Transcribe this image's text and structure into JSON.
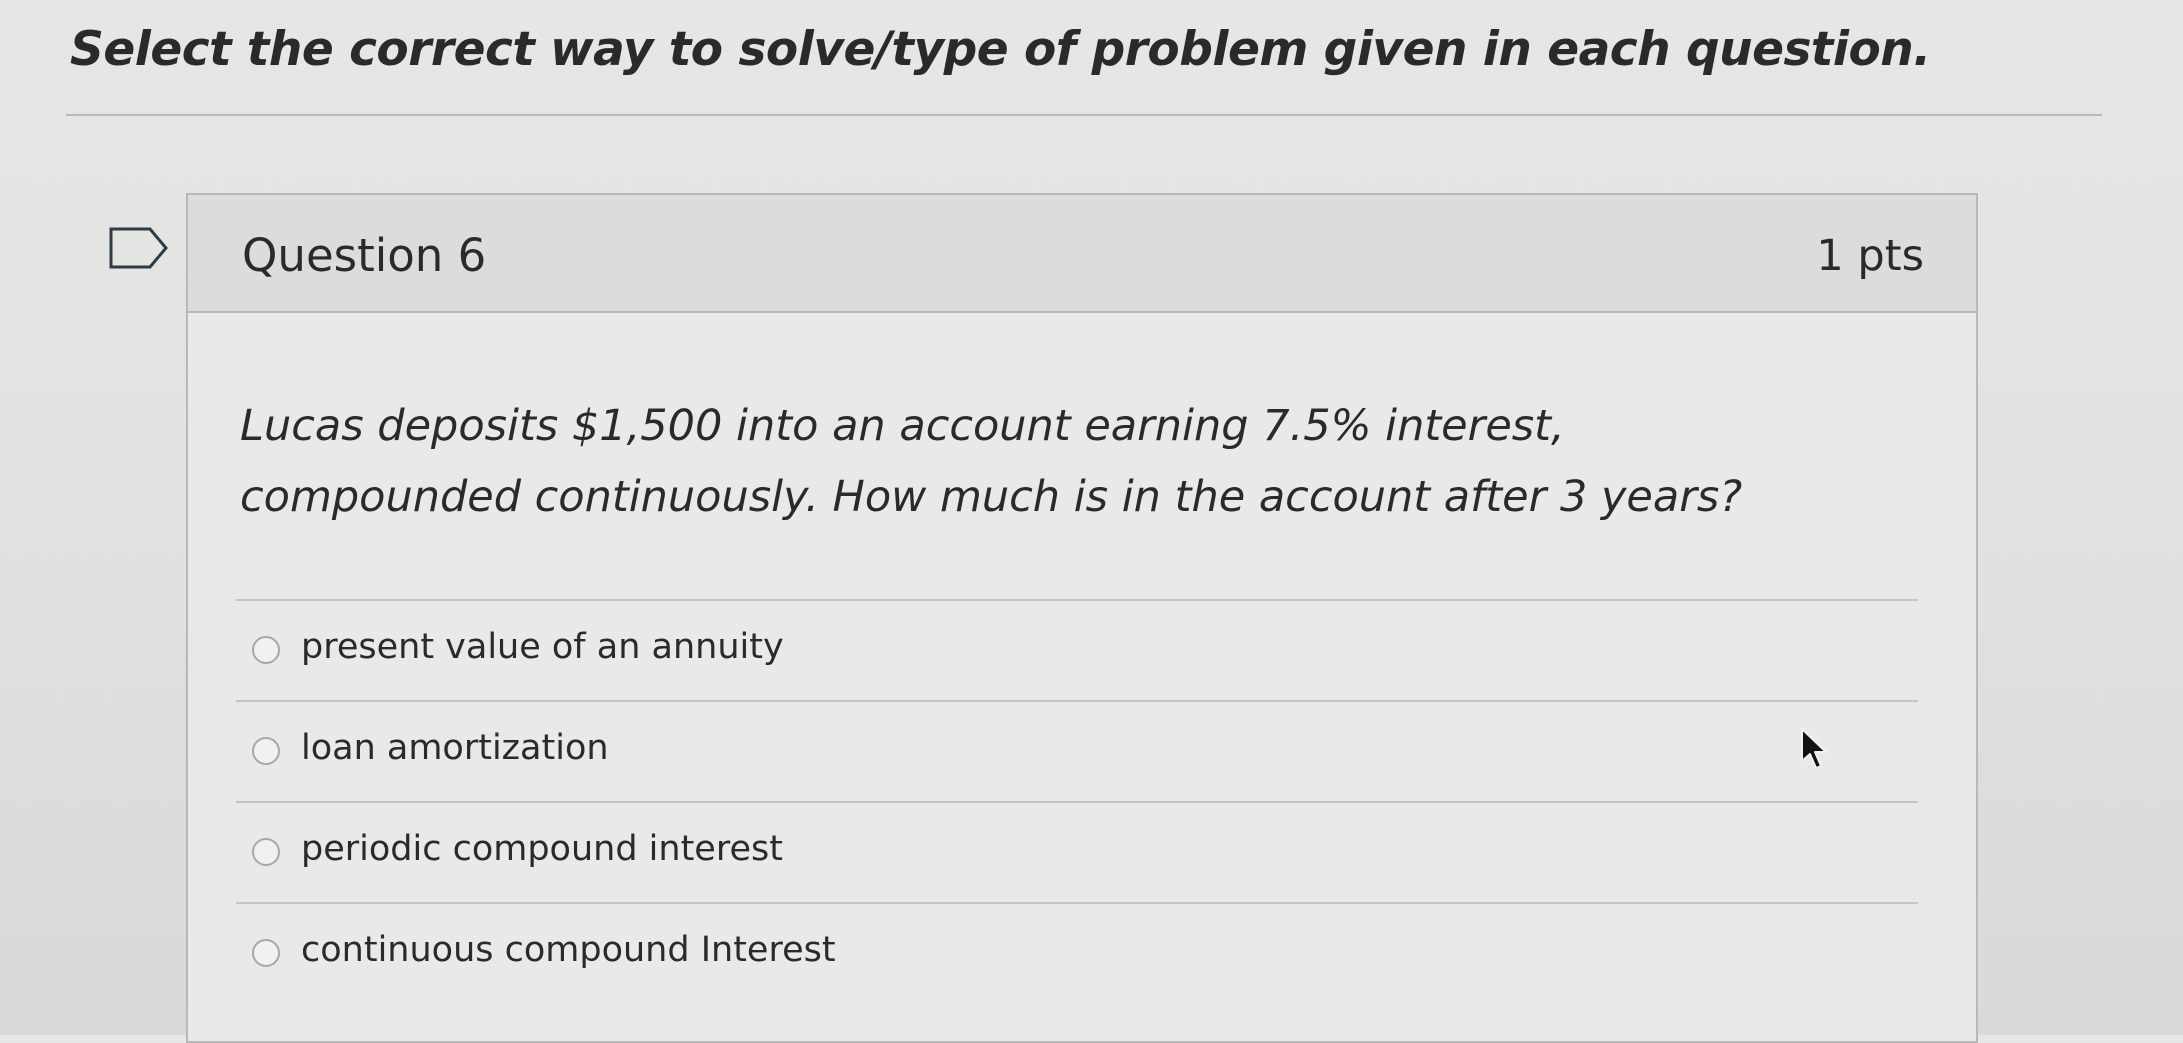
{
  "quiz": {
    "instructions": "Select the correct way to solve/type of problem given in each question."
  },
  "question": {
    "title": "Question 6",
    "points": "1 pts",
    "text": "Lucas deposits $1,500 into an account earning 7.5% interest, compounded continuously. How much is in the account after 3 years?",
    "answers": [
      {
        "label": "present value of an annuity",
        "selected": false
      },
      {
        "label": "loan amortization",
        "selected": false
      },
      {
        "label": "periodic compound interest",
        "selected": false
      },
      {
        "label": "continuous compound Interest",
        "selected": false
      }
    ]
  },
  "icons": {
    "flag": "flag-question-icon",
    "cursor": "mouse-pointer-icon"
  },
  "colors": {
    "text": "#2a2a2a",
    "background": "#e6e6e4",
    "header": "#dcdcda",
    "border": "#b8b8b6"
  }
}
